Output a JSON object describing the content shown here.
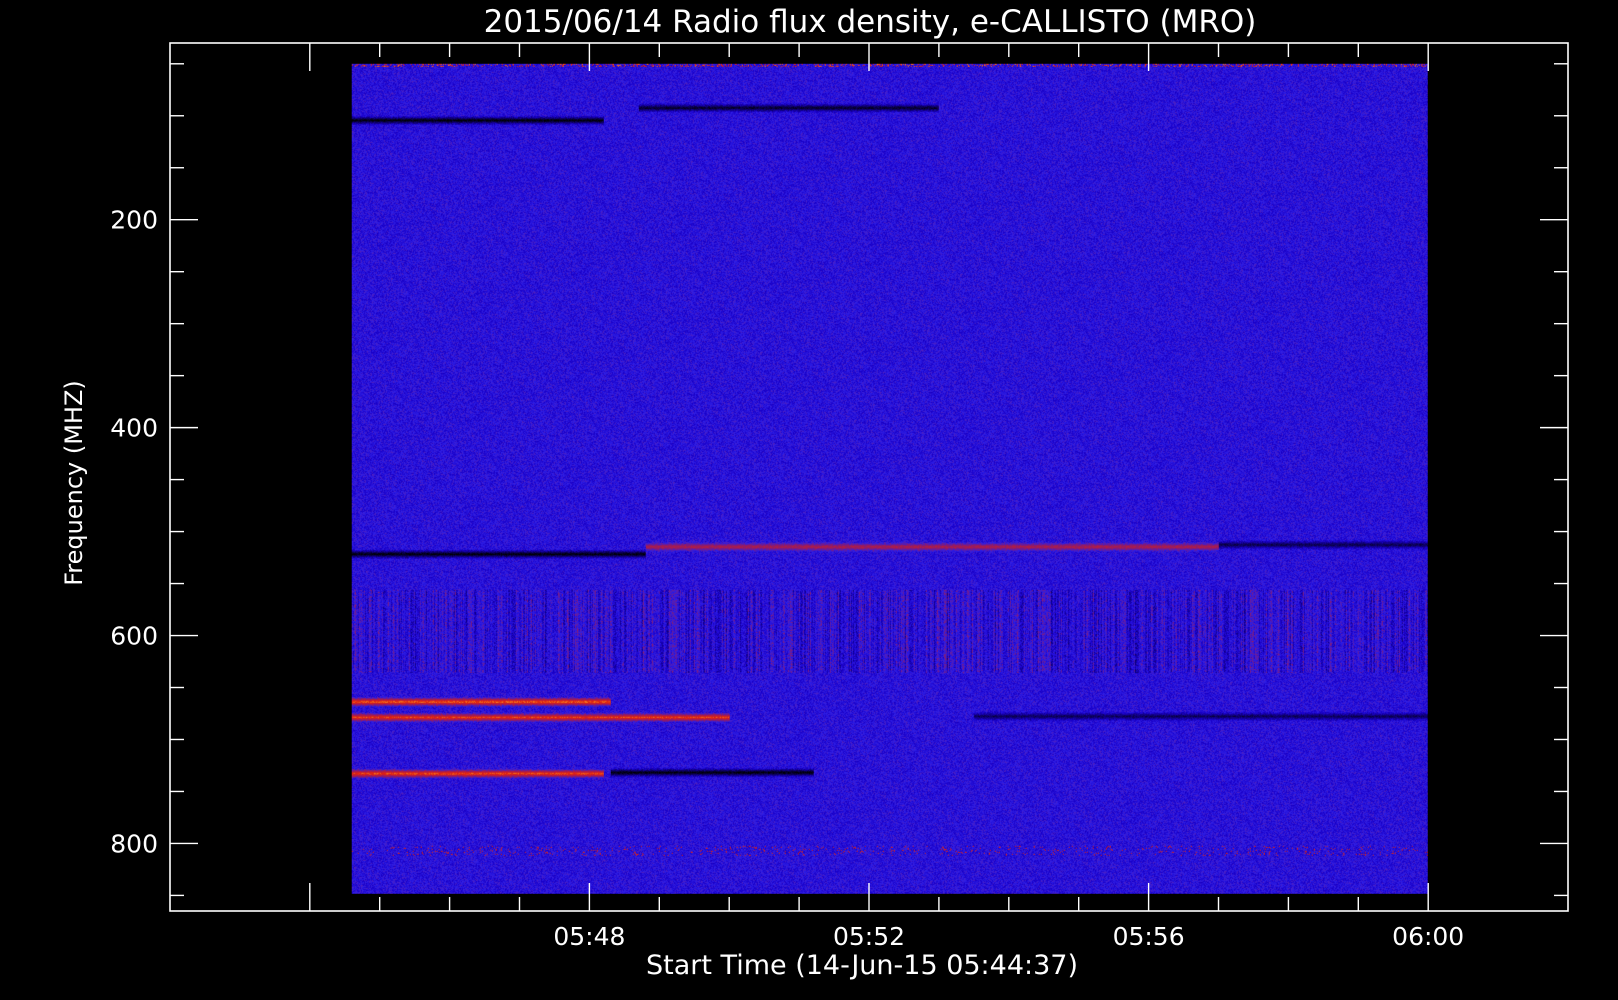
{
  "chart_data": {
    "type": "heatmap",
    "title": "2015/06/14  Radio flux density, e-CALLISTO (MRO)",
    "xlabel": "Start Time (14-Jun-15 05:44:37)",
    "ylabel": "Frequency (MHZ)",
    "x_ticks": [
      "05:48",
      "05:52",
      "05:56",
      "06:00"
    ],
    "x_tick_values_min": [
      348,
      352,
      356,
      360
    ],
    "y_ticks": [
      "200",
      "400",
      "600",
      "800"
    ],
    "y_tick_values": [
      200,
      400,
      600,
      800
    ],
    "xlim_min": [
      342,
      362
    ],
    "ylim": [
      865,
      30
    ],
    "data_extent_min": [
      344.6,
      360
    ],
    "data_extent_freq": [
      50,
      848
    ],
    "y_inverted": true,
    "colormap": [
      "#000000",
      "#1a00c8",
      "#2e1ee6",
      "#8a1a70",
      "#e02010",
      "#ffa020"
    ],
    "background_level": 0.4,
    "features": [
      {
        "name": "black band",
        "freq": 104,
        "t_start": 344.6,
        "t_end": 348.2,
        "level": 0.0
      },
      {
        "name": "black band",
        "freq": 92,
        "t_start": 348.7,
        "t_end": 353.0,
        "level": 0.05
      },
      {
        "name": "black band",
        "freq": 521,
        "t_start": 344.6,
        "t_end": 348.8,
        "level": 0.0
      },
      {
        "name": "red streak",
        "freq": 514,
        "t_start": 348.8,
        "t_end": 357.0,
        "level": 0.72
      },
      {
        "name": "dark streak",
        "freq": 512,
        "t_start": 357.0,
        "t_end": 360.0,
        "level": 0.1
      },
      {
        "name": "bright band",
        "freq": 663,
        "t_start": 344.6,
        "t_end": 348.3,
        "level": 0.95
      },
      {
        "name": "bright band",
        "freq": 678,
        "t_start": 344.6,
        "t_end": 350.0,
        "level": 0.9
      },
      {
        "name": "dark streak",
        "freq": 677,
        "t_start": 353.5,
        "t_end": 360.0,
        "level": 0.12
      },
      {
        "name": "bright band",
        "freq": 732,
        "t_start": 344.6,
        "t_end": 348.2,
        "level": 0.92
      },
      {
        "name": "black band",
        "freq": 731,
        "t_start": 348.3,
        "t_end": 351.2,
        "level": 0.0
      },
      {
        "name": "red flecks",
        "freq": 806,
        "t_start": 344.6,
        "t_end": 360.0,
        "level": 0.7
      }
    ]
  }
}
